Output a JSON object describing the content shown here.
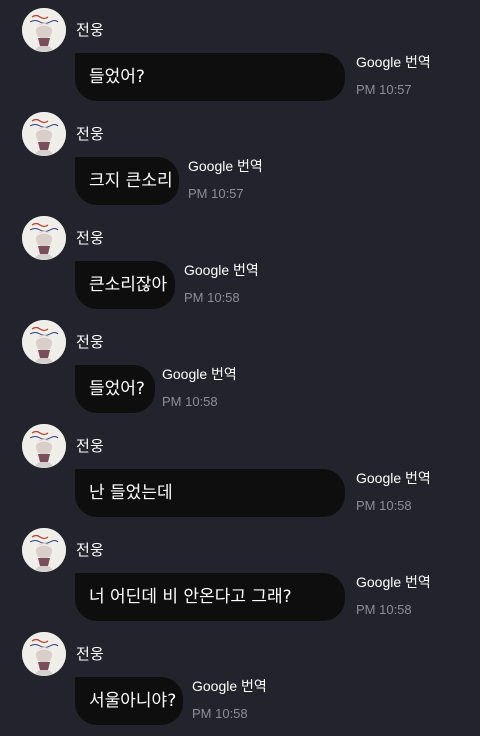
{
  "messages": [
    {
      "sender": "전웅",
      "text": "들었어?",
      "translate_label": "Google 번역",
      "time": "PM 10:57"
    },
    {
      "sender": "전웅",
      "text": "크지 큰소리",
      "translate_label": "Google 번역",
      "time": "PM 10:57"
    },
    {
      "sender": "전웅",
      "text": "큰소리잖아",
      "translate_label": "Google 번역",
      "time": "PM 10:58"
    },
    {
      "sender": "전웅",
      "text": "들었어?",
      "translate_label": "Google 번역",
      "time": "PM 10:58"
    },
    {
      "sender": "전웅",
      "text": "난 들었는데",
      "translate_label": "Google 번역",
      "time": "PM 10:58"
    },
    {
      "sender": "전웅",
      "text": "너 어딘데 비 안온다고 그래?",
      "translate_label": "Google 번역",
      "time": "PM 10:58"
    },
    {
      "sender": "전웅",
      "text": "서울아니야?",
      "translate_label": "Google 번역",
      "time": "PM 10:58"
    }
  ],
  "colors": {
    "background": "#23232e",
    "bubble": "#0e0e0e",
    "text": "#ffffff",
    "timestamp": "#8d8d98"
  }
}
